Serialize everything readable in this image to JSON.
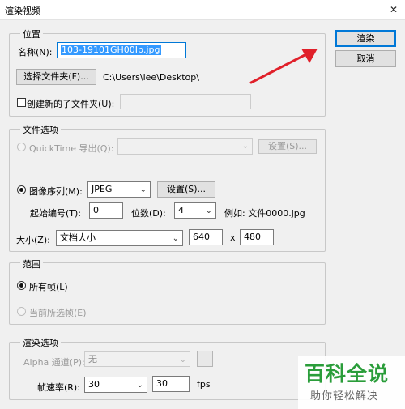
{
  "window": {
    "title": "渲染视频",
    "close": "✕"
  },
  "buttons": {
    "render": "渲染",
    "cancel": "取消"
  },
  "location": {
    "legend": "位置",
    "name_label": "名称(N):",
    "name_value": "103-19101GH00Ib.jpg",
    "choose_folder": "选择文件夹(F)...",
    "folder_path": "C:\\Users\\lee\\Desktop\\",
    "create_subfolder": "创建新的子文件夹(U):",
    "subfolder_value": ""
  },
  "file_options": {
    "legend": "文件选项",
    "quicktime_label": "QuickTime 导出(Q):",
    "quicktime_value": "",
    "quicktime_settings": "设置(S)...",
    "image_seq_label": "图像序列(M):",
    "format_value": "JPEG",
    "image_settings": "设置(S)...",
    "start_num_label": "起始编号(T):",
    "start_num_value": "0",
    "digits_label": "位数(D):",
    "digits_value": "4",
    "example": "例如: 文件0000.jpg",
    "size_label": "大小(Z):",
    "size_value": "文档大小",
    "width_value": "640",
    "times": "x",
    "height_value": "480"
  },
  "range": {
    "legend": "范围",
    "all_frames": "所有帧(L)",
    "current_selected": "当前所选帧(E)"
  },
  "render_options": {
    "legend": "渲染选项",
    "alpha_label": "Alpha 通道(P):",
    "alpha_value": "无",
    "frame_rate_label": "帧速率(R):",
    "frame_rate_select": "30",
    "frame_rate_value": "30",
    "fps": "fps"
  },
  "watermark": {
    "title": "百科全说",
    "subtitle": "助你轻松解决"
  },
  "colors": {
    "arrow": "#e0202a",
    "accent": "#0078d7",
    "watermark": "#2a9d3a"
  }
}
